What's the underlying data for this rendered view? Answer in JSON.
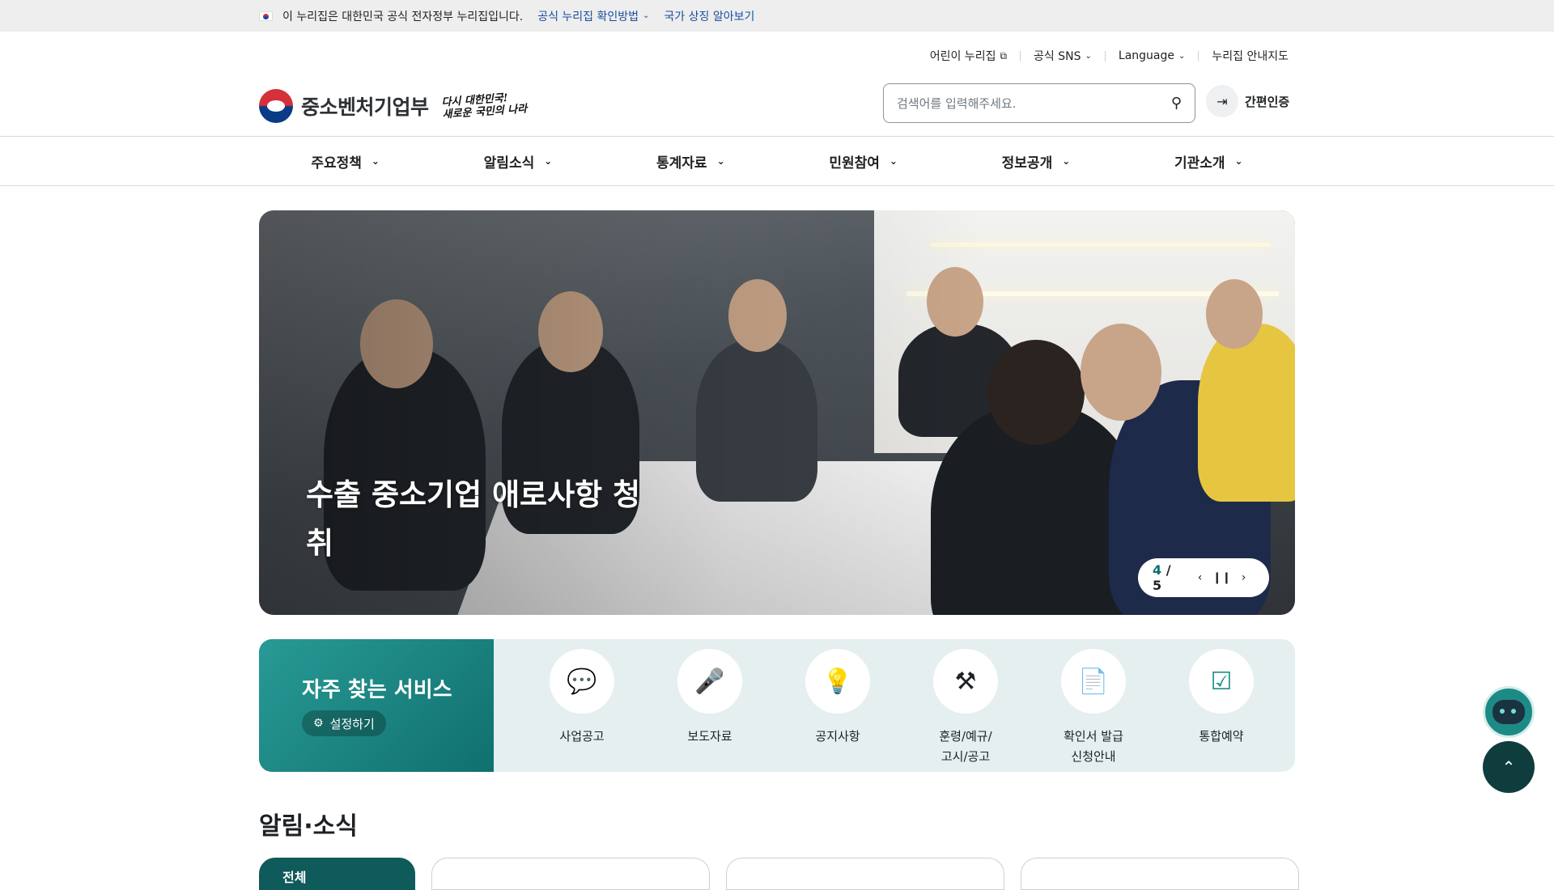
{
  "gov_banner": {
    "notice": "이 누리집은 대한민국 공식 전자정부 누리집입니다.",
    "verify_link": "공식 누리집 확인방법",
    "symbol_link": "국가 상징 알아보기"
  },
  "util_nav": {
    "kids": "어린이 누리집",
    "sns": "공식 SNS",
    "language": "Language",
    "sitemap": "누리집 안내지도"
  },
  "logo": {
    "name": "중소벤처기업부",
    "slogan_line1": "다시 대한민국!",
    "slogan_line2": "새로운 국민의 나라"
  },
  "search": {
    "placeholder": "검색어를 입력해주세요."
  },
  "login": {
    "label": "간편인증"
  },
  "gnb": {
    "items": [
      "주요정책",
      "알림소식",
      "통계자료",
      "민원참여",
      "정보공개",
      "기관소개"
    ]
  },
  "hero": {
    "caption": "수출 중소기업 애로사항 청취",
    "current": "4",
    "total": "5"
  },
  "quick_services": {
    "title": "자주 찾는 서비스",
    "setting": "설정하기",
    "items": [
      {
        "label": "사업공고",
        "icon": "speech-bubble-icon"
      },
      {
        "label": "보도자료",
        "icon": "press-podium-icon"
      },
      {
        "label": "공지사항",
        "icon": "lightbulb-icon"
      },
      {
        "label": "훈령/예규/\n고시/공고",
        "icon": "gavel-icon"
      },
      {
        "label": "확인서 발급\n신청안내",
        "icon": "document-icon"
      },
      {
        "label": "통합예약",
        "icon": "calendar-check-icon"
      }
    ]
  },
  "news": {
    "title": "알림·소식",
    "active_tab": "전체"
  },
  "colors": {
    "accent": "#10706f",
    "link": "#1a4fa0"
  }
}
